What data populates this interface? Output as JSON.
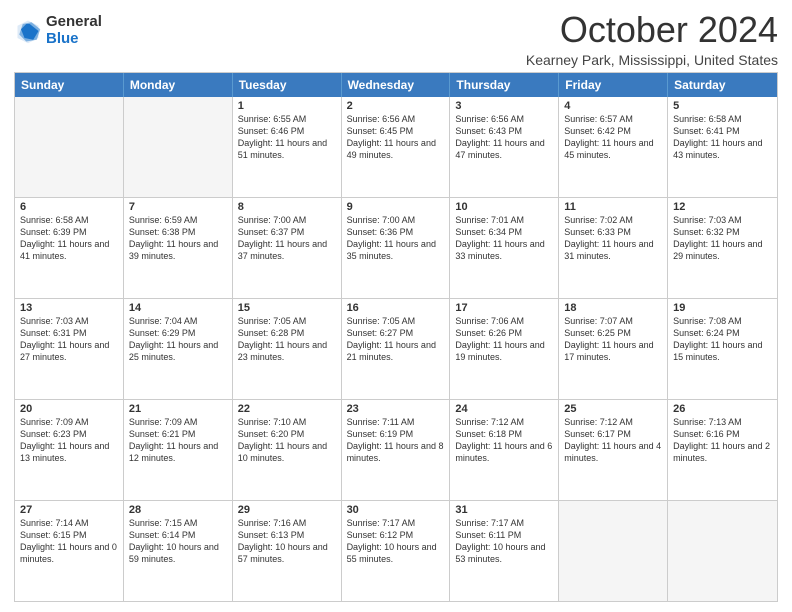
{
  "header": {
    "logo": {
      "general": "General",
      "blue": "Blue"
    },
    "title": "October 2024",
    "location": "Kearney Park, Mississippi, United States"
  },
  "calendar": {
    "days_of_week": [
      "Sunday",
      "Monday",
      "Tuesday",
      "Wednesday",
      "Thursday",
      "Friday",
      "Saturday"
    ],
    "rows": [
      [
        {
          "day": "",
          "empty": true
        },
        {
          "day": "",
          "empty": true
        },
        {
          "day": "1",
          "sunrise": "Sunrise: 6:55 AM",
          "sunset": "Sunset: 6:46 PM",
          "daylight": "Daylight: 11 hours and 51 minutes."
        },
        {
          "day": "2",
          "sunrise": "Sunrise: 6:56 AM",
          "sunset": "Sunset: 6:45 PM",
          "daylight": "Daylight: 11 hours and 49 minutes."
        },
        {
          "day": "3",
          "sunrise": "Sunrise: 6:56 AM",
          "sunset": "Sunset: 6:43 PM",
          "daylight": "Daylight: 11 hours and 47 minutes."
        },
        {
          "day": "4",
          "sunrise": "Sunrise: 6:57 AM",
          "sunset": "Sunset: 6:42 PM",
          "daylight": "Daylight: 11 hours and 45 minutes."
        },
        {
          "day": "5",
          "sunrise": "Sunrise: 6:58 AM",
          "sunset": "Sunset: 6:41 PM",
          "daylight": "Daylight: 11 hours and 43 minutes."
        }
      ],
      [
        {
          "day": "6",
          "sunrise": "Sunrise: 6:58 AM",
          "sunset": "Sunset: 6:39 PM",
          "daylight": "Daylight: 11 hours and 41 minutes."
        },
        {
          "day": "7",
          "sunrise": "Sunrise: 6:59 AM",
          "sunset": "Sunset: 6:38 PM",
          "daylight": "Daylight: 11 hours and 39 minutes."
        },
        {
          "day": "8",
          "sunrise": "Sunrise: 7:00 AM",
          "sunset": "Sunset: 6:37 PM",
          "daylight": "Daylight: 11 hours and 37 minutes."
        },
        {
          "day": "9",
          "sunrise": "Sunrise: 7:00 AM",
          "sunset": "Sunset: 6:36 PM",
          "daylight": "Daylight: 11 hours and 35 minutes."
        },
        {
          "day": "10",
          "sunrise": "Sunrise: 7:01 AM",
          "sunset": "Sunset: 6:34 PM",
          "daylight": "Daylight: 11 hours and 33 minutes."
        },
        {
          "day": "11",
          "sunrise": "Sunrise: 7:02 AM",
          "sunset": "Sunset: 6:33 PM",
          "daylight": "Daylight: 11 hours and 31 minutes."
        },
        {
          "day": "12",
          "sunrise": "Sunrise: 7:03 AM",
          "sunset": "Sunset: 6:32 PM",
          "daylight": "Daylight: 11 hours and 29 minutes."
        }
      ],
      [
        {
          "day": "13",
          "sunrise": "Sunrise: 7:03 AM",
          "sunset": "Sunset: 6:31 PM",
          "daylight": "Daylight: 11 hours and 27 minutes."
        },
        {
          "day": "14",
          "sunrise": "Sunrise: 7:04 AM",
          "sunset": "Sunset: 6:29 PM",
          "daylight": "Daylight: 11 hours and 25 minutes."
        },
        {
          "day": "15",
          "sunrise": "Sunrise: 7:05 AM",
          "sunset": "Sunset: 6:28 PM",
          "daylight": "Daylight: 11 hours and 23 minutes."
        },
        {
          "day": "16",
          "sunrise": "Sunrise: 7:05 AM",
          "sunset": "Sunset: 6:27 PM",
          "daylight": "Daylight: 11 hours and 21 minutes."
        },
        {
          "day": "17",
          "sunrise": "Sunrise: 7:06 AM",
          "sunset": "Sunset: 6:26 PM",
          "daylight": "Daylight: 11 hours and 19 minutes."
        },
        {
          "day": "18",
          "sunrise": "Sunrise: 7:07 AM",
          "sunset": "Sunset: 6:25 PM",
          "daylight": "Daylight: 11 hours and 17 minutes."
        },
        {
          "day": "19",
          "sunrise": "Sunrise: 7:08 AM",
          "sunset": "Sunset: 6:24 PM",
          "daylight": "Daylight: 11 hours and 15 minutes."
        }
      ],
      [
        {
          "day": "20",
          "sunrise": "Sunrise: 7:09 AM",
          "sunset": "Sunset: 6:23 PM",
          "daylight": "Daylight: 11 hours and 13 minutes."
        },
        {
          "day": "21",
          "sunrise": "Sunrise: 7:09 AM",
          "sunset": "Sunset: 6:21 PM",
          "daylight": "Daylight: 11 hours and 12 minutes."
        },
        {
          "day": "22",
          "sunrise": "Sunrise: 7:10 AM",
          "sunset": "Sunset: 6:20 PM",
          "daylight": "Daylight: 11 hours and 10 minutes."
        },
        {
          "day": "23",
          "sunrise": "Sunrise: 7:11 AM",
          "sunset": "Sunset: 6:19 PM",
          "daylight": "Daylight: 11 hours and 8 minutes."
        },
        {
          "day": "24",
          "sunrise": "Sunrise: 7:12 AM",
          "sunset": "Sunset: 6:18 PM",
          "daylight": "Daylight: 11 hours and 6 minutes."
        },
        {
          "day": "25",
          "sunrise": "Sunrise: 7:12 AM",
          "sunset": "Sunset: 6:17 PM",
          "daylight": "Daylight: 11 hours and 4 minutes."
        },
        {
          "day": "26",
          "sunrise": "Sunrise: 7:13 AM",
          "sunset": "Sunset: 6:16 PM",
          "daylight": "Daylight: 11 hours and 2 minutes."
        }
      ],
      [
        {
          "day": "27",
          "sunrise": "Sunrise: 7:14 AM",
          "sunset": "Sunset: 6:15 PM",
          "daylight": "Daylight: 11 hours and 0 minutes."
        },
        {
          "day": "28",
          "sunrise": "Sunrise: 7:15 AM",
          "sunset": "Sunset: 6:14 PM",
          "daylight": "Daylight: 10 hours and 59 minutes."
        },
        {
          "day": "29",
          "sunrise": "Sunrise: 7:16 AM",
          "sunset": "Sunset: 6:13 PM",
          "daylight": "Daylight: 10 hours and 57 minutes."
        },
        {
          "day": "30",
          "sunrise": "Sunrise: 7:17 AM",
          "sunset": "Sunset: 6:12 PM",
          "daylight": "Daylight: 10 hours and 55 minutes."
        },
        {
          "day": "31",
          "sunrise": "Sunrise: 7:17 AM",
          "sunset": "Sunset: 6:11 PM",
          "daylight": "Daylight: 10 hours and 53 minutes."
        },
        {
          "day": "",
          "empty": true
        },
        {
          "day": "",
          "empty": true
        }
      ]
    ]
  }
}
